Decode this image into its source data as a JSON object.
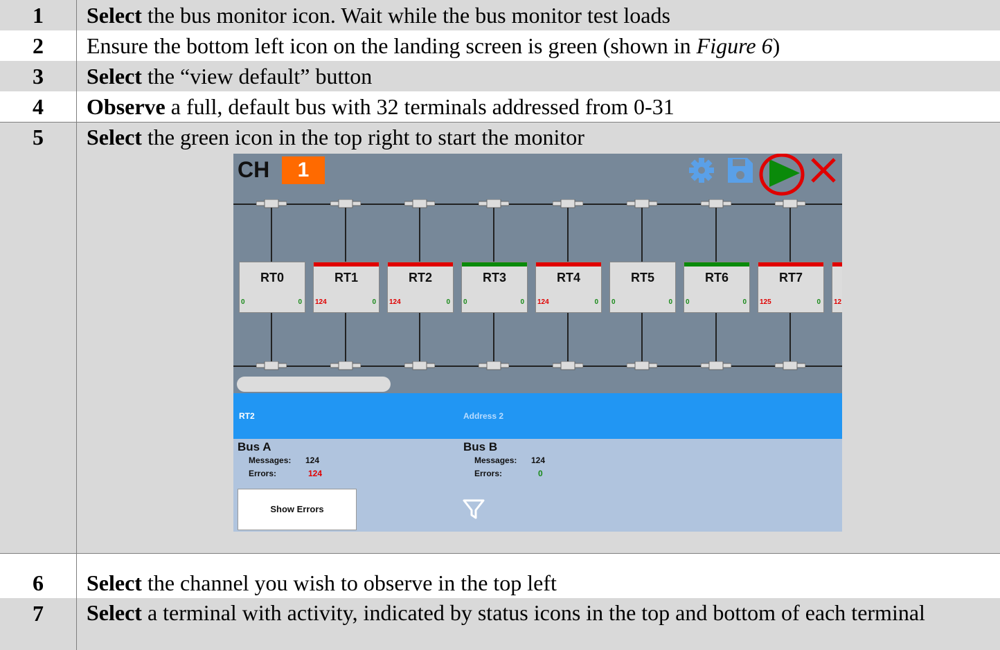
{
  "steps": [
    {
      "num": "1",
      "bold": "Select",
      "rest": " the bus monitor icon. Wait while the bus monitor test loads"
    },
    {
      "num": "2",
      "bold": "",
      "rest": "Ensure the bottom left icon on the landing screen is green (shown in ",
      "italic": "Figure 6",
      "rest2": ")"
    },
    {
      "num": "3",
      "bold": "Select",
      "rest": " the “view default” button"
    },
    {
      "num": "4",
      "bold": "Observe",
      "rest": " a full, default bus with 32 terminals addressed from 0-31"
    },
    {
      "num": "5",
      "bold": "Select",
      "rest": " the green icon in the top right to start the monitor"
    },
    {
      "num": "6",
      "bold": "Select",
      "rest": " the channel you wish to observe in the top left"
    },
    {
      "num": "7",
      "bold": "Select",
      "rest": " a terminal with activity, indicated by status icons in the top and bottom of each terminal"
    }
  ],
  "screenshot": {
    "channel_label": "CH",
    "channel_number": "1",
    "icons": [
      "gear-icon",
      "save-icon",
      "play-icon",
      "close-icon"
    ],
    "highlight_color": "#e00000",
    "terminals": [
      {
        "name": "RT0",
        "status": "none",
        "left_count": "0",
        "right_count": "0",
        "left_color": "#1a8a1a"
      },
      {
        "name": "RT1",
        "status": "red",
        "left_count": "124",
        "right_count": "0",
        "left_color": "#e00000"
      },
      {
        "name": "RT2",
        "status": "red",
        "left_count": "124",
        "right_count": "0",
        "left_color": "#e00000"
      },
      {
        "name": "RT3",
        "status": "green",
        "left_count": "0",
        "right_count": "0",
        "left_color": "#1a8a1a"
      },
      {
        "name": "RT4",
        "status": "red",
        "left_count": "124",
        "right_count": "0",
        "left_color": "#e00000"
      },
      {
        "name": "RT5",
        "status": "none",
        "left_count": "0",
        "right_count": "0",
        "left_color": "#1a8a1a"
      },
      {
        "name": "RT6",
        "status": "green",
        "left_count": "0",
        "right_count": "0",
        "left_color": "#1a8a1a"
      },
      {
        "name": "RT7",
        "status": "red",
        "left_count": "125",
        "right_count": "0",
        "left_color": "#e00000"
      },
      {
        "name": "",
        "status": "red",
        "left_count": "12",
        "right_count": "",
        "left_color": "#e00000"
      }
    ],
    "detail": {
      "name": "RT2",
      "address": "Address 2",
      "bus_a": {
        "title": "Bus A",
        "messages_label": "Messages:",
        "messages": "124",
        "errors_label": "Errors:",
        "errors": "124"
      },
      "bus_b": {
        "title": "Bus B",
        "messages_label": "Messages:",
        "messages": "124",
        "errors_label": "Errors:",
        "errors": "0"
      },
      "show_errors": "Show Errors"
    }
  }
}
